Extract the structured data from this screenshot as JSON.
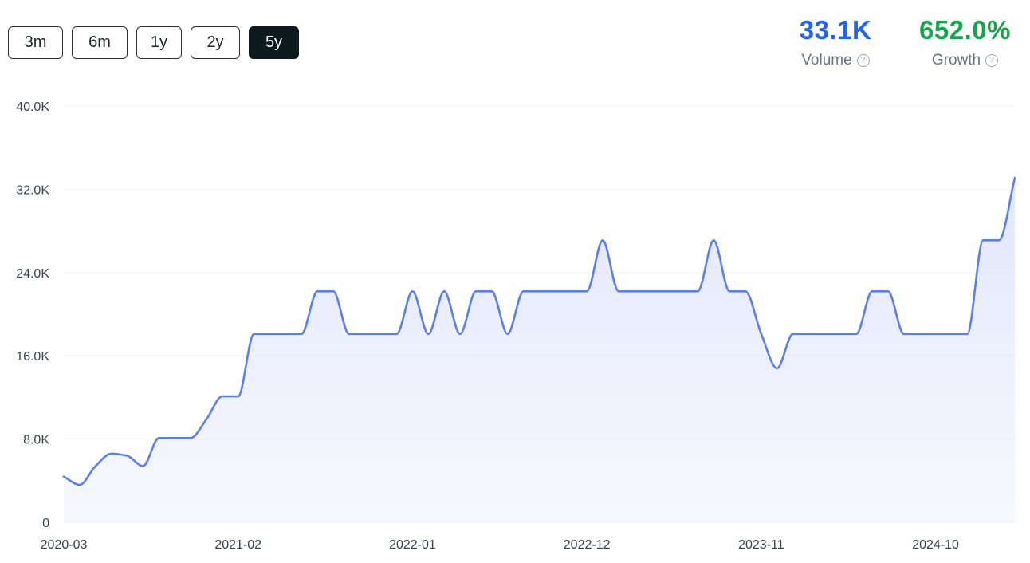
{
  "range_buttons": [
    {
      "label": "3m",
      "active": false
    },
    {
      "label": "6m",
      "active": false
    },
    {
      "label": "1y",
      "active": false
    },
    {
      "label": "2y",
      "active": false
    },
    {
      "label": "5y",
      "active": true
    }
  ],
  "stats": {
    "volume": {
      "value": "33.1K",
      "label": "Volume",
      "color": "#2563eb"
    },
    "growth": {
      "value": "652.0%",
      "label": "Growth",
      "color": "#16a34a"
    }
  },
  "help_glyph": "?",
  "chart_data": {
    "type": "area",
    "line_color": "#5b7fe6",
    "fill_color": "#dfe4fb",
    "ylim": [
      0,
      40000
    ],
    "y_ticks": [
      0,
      8000,
      16000,
      24000,
      32000,
      40000
    ],
    "y_tick_labels": [
      "0",
      "8.0K",
      "16.0K",
      "24.0K",
      "32.0K",
      "40.0K"
    ],
    "x_tick_labels": [
      "2020-03",
      "2021-02",
      "2022-01",
      "2022-12",
      "2023-11",
      "2024-10"
    ],
    "grid": true,
    "x": [
      "2020-03",
      "2020-04",
      "2020-05",
      "2020-06",
      "2020-07",
      "2020-08",
      "2020-09",
      "2020-10",
      "2020-11",
      "2020-12",
      "2021-01",
      "2021-02",
      "2021-03",
      "2021-04",
      "2021-05",
      "2021-06",
      "2021-07",
      "2021-08",
      "2021-09",
      "2021-10",
      "2021-11",
      "2021-12",
      "2022-01",
      "2022-02",
      "2022-03",
      "2022-04",
      "2022-05",
      "2022-06",
      "2022-07",
      "2022-08",
      "2022-09",
      "2022-10",
      "2022-11",
      "2022-12",
      "2023-01",
      "2023-02",
      "2023-03",
      "2023-04",
      "2023-05",
      "2023-06",
      "2023-07",
      "2023-08",
      "2023-09",
      "2023-10",
      "2023-11",
      "2023-12",
      "2024-01",
      "2024-02",
      "2024-03",
      "2024-04",
      "2024-05",
      "2024-06",
      "2024-07",
      "2024-08",
      "2024-09",
      "2024-10",
      "2024-11",
      "2024-12",
      "2025-01",
      "2025-02",
      "2025-03"
    ],
    "values": [
      4400,
      3600,
      5400,
      6600,
      6400,
      5400,
      8100,
      8100,
      8100,
      9900,
      12100,
      12100,
      18100,
      18100,
      18100,
      18100,
      22200,
      22200,
      18100,
      18100,
      18100,
      18100,
      22200,
      18100,
      22200,
      18100,
      22200,
      22200,
      18100,
      22200,
      22200,
      22200,
      22200,
      22200,
      27100,
      22200,
      22200,
      22200,
      22200,
      22200,
      22200,
      27100,
      22200,
      22200,
      18100,
      14800,
      18100,
      18100,
      18100,
      18100,
      18100,
      22200,
      22200,
      18100,
      18100,
      18100,
      18100,
      18100,
      27100,
      27100,
      33100
    ]
  }
}
